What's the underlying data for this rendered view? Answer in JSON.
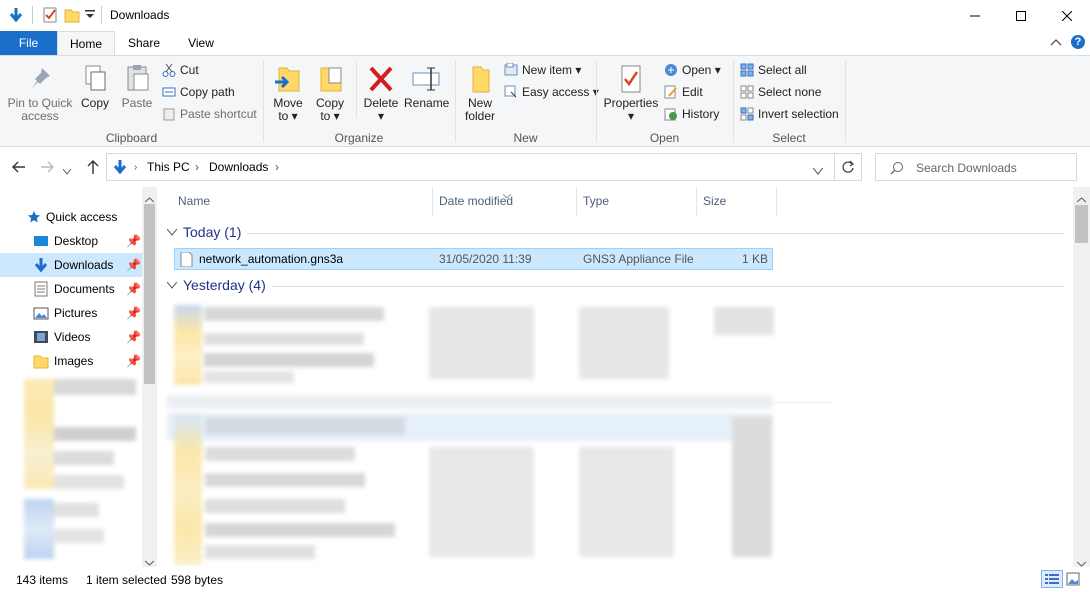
{
  "window": {
    "title": "Downloads",
    "qa_icons": [
      "down-arrow-icon",
      "properties-check-icon",
      "new-folder-icon",
      "customize-dropdown-icon"
    ]
  },
  "tabs": [
    "File",
    "Home",
    "Share",
    "View"
  ],
  "ribbon": {
    "clipboard": {
      "pin": [
        "Pin to Quick",
        "access"
      ],
      "copy": "Copy",
      "paste": "Paste",
      "cut": "Cut",
      "copy_path": "Copy path",
      "paste_shortcut": "Paste shortcut",
      "label": "Clipboard"
    },
    "organize": {
      "move_to": [
        "Move",
        "to ▾"
      ],
      "copy_to": [
        "Copy",
        "to ▾"
      ],
      "delete": [
        "Delete",
        "▾"
      ],
      "rename": "Rename",
      "label": "Organize"
    },
    "new": {
      "new_folder": [
        "New",
        "folder"
      ],
      "new_item": "New item ▾",
      "easy_access": "Easy access ▾",
      "label": "New"
    },
    "open": {
      "properties": [
        "Properties",
        "▾"
      ],
      "open": "Open ▾",
      "edit": "Edit",
      "history": "History",
      "label": "Open"
    },
    "select": {
      "select_all": "Select all",
      "select_none": "Select none",
      "invert": "Invert selection",
      "label": "Select"
    }
  },
  "address": {
    "crumbs": [
      "This PC",
      "Downloads"
    ],
    "search_placeholder": "Search Downloads"
  },
  "nav": {
    "items": [
      {
        "label": "Quick access",
        "icon": "star-icon"
      },
      {
        "label": "Desktop",
        "icon": "desktop-icon",
        "pinned": true
      },
      {
        "label": "Downloads",
        "icon": "downloads-icon",
        "pinned": true
      },
      {
        "label": "Documents",
        "icon": "documents-icon",
        "pinned": true
      },
      {
        "label": "Pictures",
        "icon": "pictures-icon",
        "pinned": true
      },
      {
        "label": "Videos",
        "icon": "videos-icon",
        "pinned": true
      },
      {
        "label": "Images",
        "icon": "folder-icon",
        "pinned": true
      }
    ]
  },
  "columns": [
    "Name",
    "Date modified",
    "Type",
    "Size"
  ],
  "groups": {
    "today": "Today (1)",
    "yesterday": "Yesterday (4)"
  },
  "files": [
    {
      "name": "network_automation.gns3a",
      "date": "31/05/2020 11:39",
      "type": "GNS3 Appliance File",
      "size": "1 KB"
    }
  ],
  "status": {
    "count": "143 items",
    "selected": "1 item selected",
    "size": "598 bytes"
  },
  "colors": {
    "accent": "#1a6fc9",
    "selection": "#cce8ff",
    "group_header": "#1e3287"
  }
}
